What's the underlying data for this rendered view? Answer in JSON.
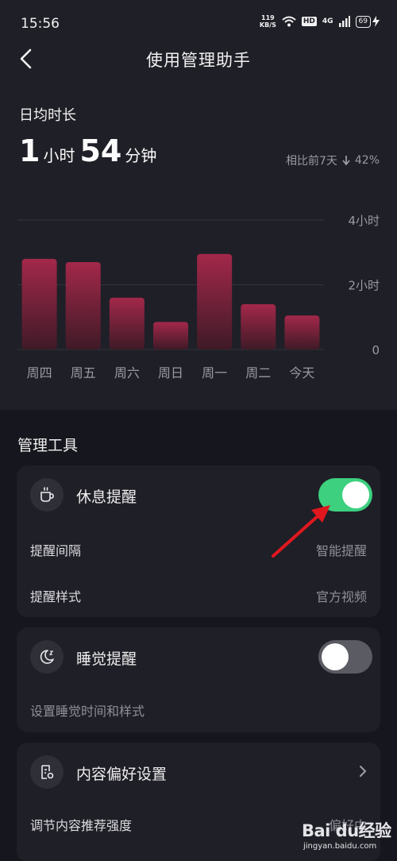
{
  "status_bar": {
    "time": "15:56",
    "net_speed_value": "119",
    "net_speed_unit": "KB/S",
    "hd_badge": "HD",
    "network_type": "4G",
    "battery_level": "69"
  },
  "header": {
    "title": "使用管理助手"
  },
  "usage": {
    "label": "日均时长",
    "hours_value": "1",
    "hours_unit": "小时",
    "minutes_value": "54",
    "minutes_unit": "分钟",
    "compare_label": "相比前7天",
    "compare_change": "42%",
    "compare_direction": "down"
  },
  "chart_data": {
    "type": "bar",
    "categories": [
      "周四",
      "周五",
      "周六",
      "周日",
      "周一",
      "周二",
      "今天"
    ],
    "values": [
      2.8,
      2.7,
      1.6,
      0.85,
      2.95,
      1.4,
      1.05
    ],
    "y_unit": "hours",
    "ylim": [
      0,
      4
    ],
    "y_tick_labels": [
      "4小时",
      "2小时",
      "0"
    ],
    "y_tick_values": [
      4,
      2,
      0
    ],
    "grid": true,
    "bar_color_top": "#a3284a",
    "bar_color_bottom": "#3f1a27"
  },
  "tools": {
    "section_title": "管理工具",
    "rest_reminder": {
      "title": "休息提醒",
      "enabled": true,
      "interval_label": "提醒间隔",
      "interval_value": "智能提醒",
      "style_label": "提醒样式",
      "style_value": "官方视频"
    },
    "sleep_reminder": {
      "title": "睡觉提醒",
      "enabled": false,
      "subtitle": "设置睡觉时间和样式"
    },
    "content_pref": {
      "title": "内容偏好设置",
      "strength_label": "调节内容推荐强度",
      "strength_value": "偏好中"
    }
  },
  "watermark": {
    "main": "Bai du经验",
    "sub": "jingyan.baidu.com"
  },
  "colors": {
    "background": "#16161e",
    "card": "#1f1f27",
    "toggle_on": "#3dd07f",
    "toggle_off": "#5b5b64",
    "annotation_arrow": "#e0181e"
  }
}
